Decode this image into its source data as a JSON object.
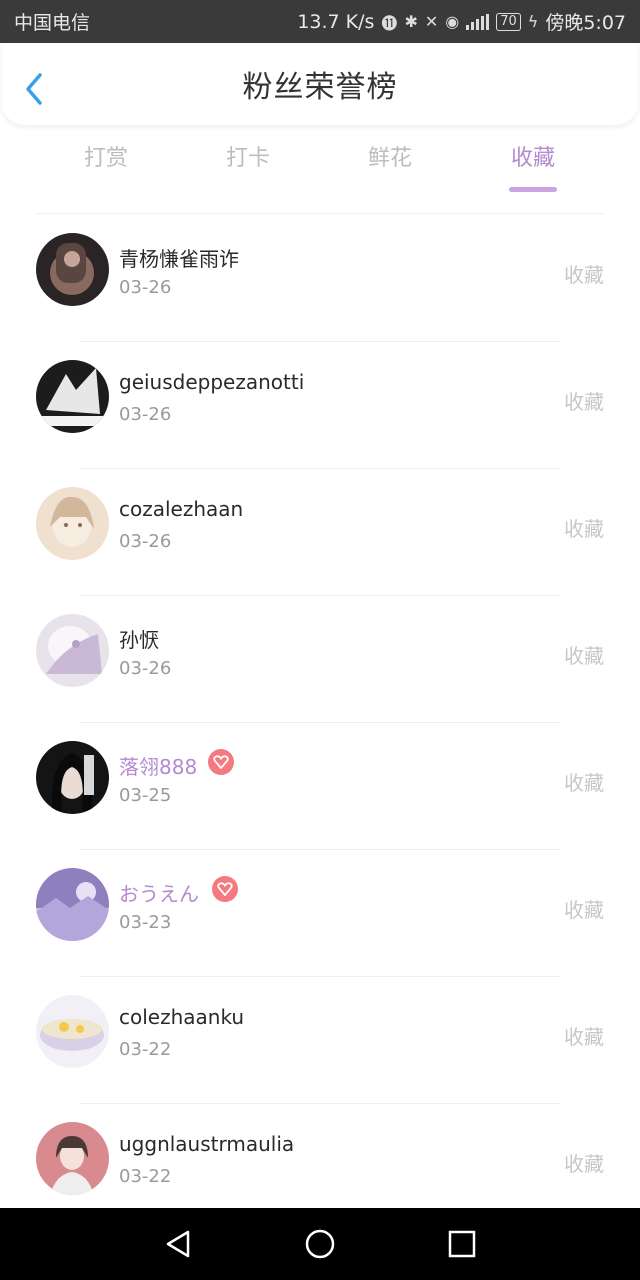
{
  "status_bar": {
    "carrier": "中国电信",
    "speed": "13.7 K/s",
    "battery": "70",
    "time": "傍晚5:07"
  },
  "header": {
    "title": "粉丝荣誉榜",
    "back_icon": "chevron-left-icon"
  },
  "tabs": [
    {
      "label": "打赏",
      "active": false
    },
    {
      "label": "打卡",
      "active": false
    },
    {
      "label": "鲜花",
      "active": false
    },
    {
      "label": "收藏",
      "active": true
    }
  ],
  "list": [
    {
      "name": "青杨慊雀雨诈",
      "date": "03-26",
      "action": "收藏",
      "vip": false
    },
    {
      "name": "geiusdeppezanotti",
      "date": "03-26",
      "action": "收藏",
      "vip": false
    },
    {
      "name": "cozalezhaan",
      "date": "03-26",
      "action": "收藏",
      "vip": false
    },
    {
      "name": "孙恹",
      "date": "03-26",
      "action": "收藏",
      "vip": false
    },
    {
      "name": "落翎888",
      "date": "03-25",
      "action": "收藏",
      "vip": true
    },
    {
      "name": "おうえん",
      "date": "03-23",
      "action": "收藏",
      "vip": true
    },
    {
      "name": "colezhaanku",
      "date": "03-22",
      "action": "收藏",
      "vip": false
    },
    {
      "name": "uggnlaustrmaulia",
      "date": "03-22",
      "action": "收藏",
      "vip": false
    }
  ],
  "colors": {
    "accent": "#b58ad0",
    "vip_badge": "#f47a80",
    "back_arrow": "#3aa0e8"
  }
}
